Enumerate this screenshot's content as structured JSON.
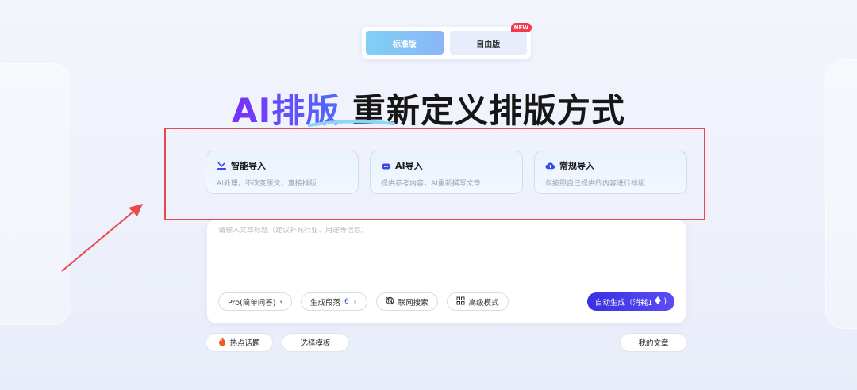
{
  "version_switch": {
    "standard_label": "标准版",
    "free_label": "自由版",
    "new_badge": "NEW"
  },
  "hero": {
    "accent_text": "AI排版",
    "rest_text": "重新定义排版方式"
  },
  "import_cards": [
    {
      "title": "智能导入",
      "desc": "AI处理，不改变原文，直接排版",
      "icon": "smart-import-icon"
    },
    {
      "title": "AI导入",
      "desc": "提供参考内容，AI重新撰写文章",
      "icon": "robot-icon"
    },
    {
      "title": "常规导入",
      "desc": "仅按照自己提供的内容进行排版",
      "icon": "cloud-upload-icon"
    }
  ],
  "editor": {
    "title_placeholder": "请输入文章标题（建议补充行业、用途等信息）",
    "mode_label": "Pro(简单问答)",
    "paragraph_label": "生成段落",
    "paragraph_value": "6",
    "web_search_label": "联网搜索",
    "advanced_label": "高级模式",
    "generate_label": "自动生成（消耗1"
  },
  "bottom": {
    "hot_topics_label": "热点话题",
    "select_template_label": "选择模板",
    "my_articles_label": "我的文章"
  },
  "colors": {
    "accent_purple": "#7b2ff7",
    "accent_blue": "#4f6bff",
    "highlight_red": "#e9484f",
    "generate_bg": "#3b2fe0"
  }
}
